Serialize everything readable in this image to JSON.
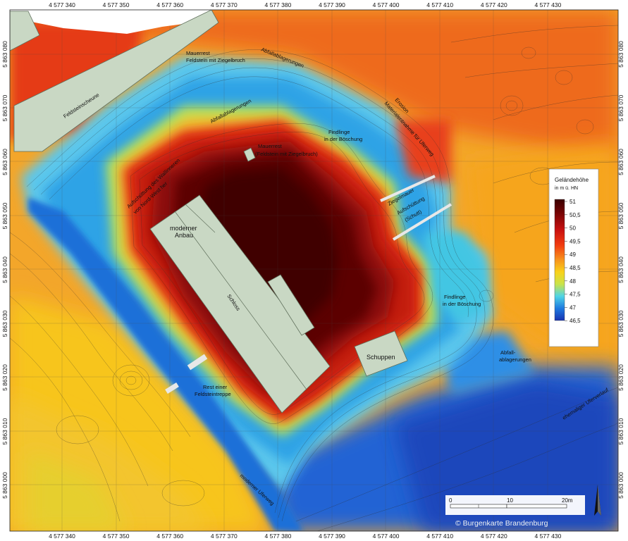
{
  "map": {
    "x_ticks": [
      "4 577 340",
      "4 577 350",
      "4 577 360",
      "4 577 370",
      "4 577 380",
      "4 577 390",
      "4 577 400",
      "4 577 410",
      "4 577 420",
      "4 577 430"
    ],
    "y_ticks": [
      "5 863 080",
      "5 863 070",
      "5 863 060",
      "5 863 050",
      "5 863 040",
      "5 863 030",
      "5 863 020",
      "5 863 010",
      "5 863 000"
    ],
    "labels": {
      "feldsteinscheune": "Feldsteinscheune",
      "mauerrest_top": "Mauerrest",
      "mauerrest_top2": "Feldstein mit Ziegelbruch",
      "abfall_top": "Abfallablagerungen",
      "abfall_left": "Abfallablagerungen",
      "erosion": "Erosion",
      "erosion2": "Materialentnahme für Uferweg",
      "findlinge1": "Findlinge",
      "findlinge1b": "in der Böschung",
      "mauerrest_mid": "Mauerrest",
      "mauerrest_mid2": "(Feldstein mit Ziegelbruch)",
      "aufschuettung": "Aufschüttung des Wallinneren",
      "aufschuettung2": "von Nord-West her",
      "ziegelmauer": "Ziegelmauer",
      "aufschuettung_ab": "Aufschüttung",
      "aufschuettung_ab2": "(Schutt)",
      "moderner": "moderner",
      "anbau": "Anbau",
      "schloss": "Schloss",
      "schuppen": "Schuppen",
      "findlinge2": "Findlinge",
      "findlinge2b": "in der Böschung",
      "abfall_right": "Abfall-",
      "abfall_right2": "ablagerungen",
      "rest_treppe": "Rest einer",
      "rest_treppe2": "Feldsteintreppe",
      "ehemaliger": "ehemaliger Uferverlauf",
      "moderner_weg": "moderner Uferweg"
    },
    "legend": {
      "title": "Geländehöhe",
      "unit": "in m ü. HN",
      "values": [
        "51",
        "50,5",
        "50",
        "49,5",
        "49",
        "48,5",
        "48",
        "47,5",
        "47",
        "46,5"
      ],
      "colors": [
        "#3a0000",
        "#7a0505",
        "#c81010",
        "#f23d10",
        "#f7941d",
        "#f9d21a",
        "#c9e34a",
        "#4fd4e6",
        "#1e7ae0",
        "#1833b0"
      ]
    },
    "scalebar": {
      "labels": [
        "0",
        "10",
        "20m"
      ]
    },
    "copyright": "© Burgenkarte Brandenburg"
  }
}
